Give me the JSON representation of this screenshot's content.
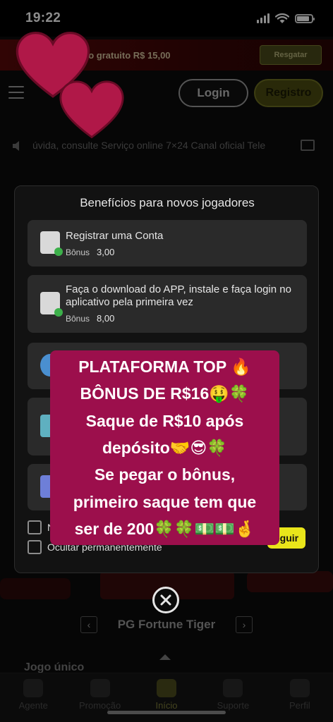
{
  "status_bar": {
    "time": "19:22"
  },
  "promo": {
    "text": "ão gratuito R$ 15,00",
    "button": "Resgatar"
  },
  "header": {
    "login": "Login",
    "register": "Registro"
  },
  "marquee": {
    "text": "úvida, consulte Serviço online 7×24 Canal oficial Tele"
  },
  "modal": {
    "title": "Benefícios para novos jogadores",
    "cards": [
      {
        "title": "Registrar uma Conta",
        "bonus_label": "Bônus",
        "bonus_value": "3,00"
      },
      {
        "title": "Faça o download do APP, instale e faça login no aplicativo pela primeira vez",
        "bonus_label": "Bônus",
        "bonus_value": "8,00"
      }
    ],
    "checkbox_hide": "Ocultar permanentemente",
    "checkbox_partial": "N",
    "follow_button": "eguir"
  },
  "sticker": {
    "lines": [
      "PLATAFORMA TOP 🔥",
      "BÔNUS DE R$16🤑🍀",
      "Saque de R$10 após",
      "depósito🤝😎🍀",
      "Se pegar o bônus,",
      "primeiro saque tem que",
      "ser de 200🍀🍀💵💵🤞"
    ]
  },
  "game": {
    "title": "PG Fortune Tiger"
  },
  "section": {
    "title": "Jogo único"
  },
  "bottom_nav": [
    {
      "label": "Agente"
    },
    {
      "label": "Promoção"
    },
    {
      "label": "Início"
    },
    {
      "label": "Suporte"
    },
    {
      "label": "Perfil"
    }
  ],
  "colors": {
    "accent": "#e9e51a",
    "sticker": "#9c0f4c",
    "heart": "#b01848"
  }
}
